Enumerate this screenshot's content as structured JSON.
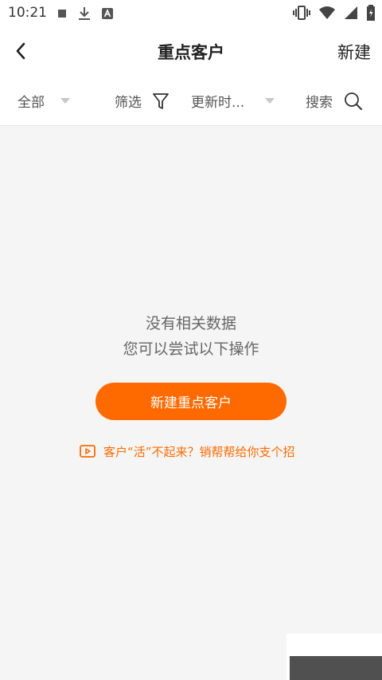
{
  "status_bar": {
    "time": "10:21",
    "left_icons": [
      "square-notification-icon",
      "download-icon",
      "a-badge-icon"
    ],
    "right_icons": [
      "vibrate-icon",
      "wifi-icon",
      "signal-icon",
      "battery-charging-icon"
    ]
  },
  "nav": {
    "title": "重点客户",
    "new_label": "新建"
  },
  "filters": {
    "all_label": "全部",
    "filter_label": "筛选",
    "sort_label": "更新时...",
    "search_label": "搜索"
  },
  "empty_state": {
    "line1": "没有相关数据",
    "line2": "您可以尝试以下操作",
    "create_button": "新建重点客户",
    "tip": "客户“活”不起来？销帮帮给你支个招"
  },
  "colors": {
    "accent": "#ff6a00",
    "background": "#f5f5f5"
  }
}
